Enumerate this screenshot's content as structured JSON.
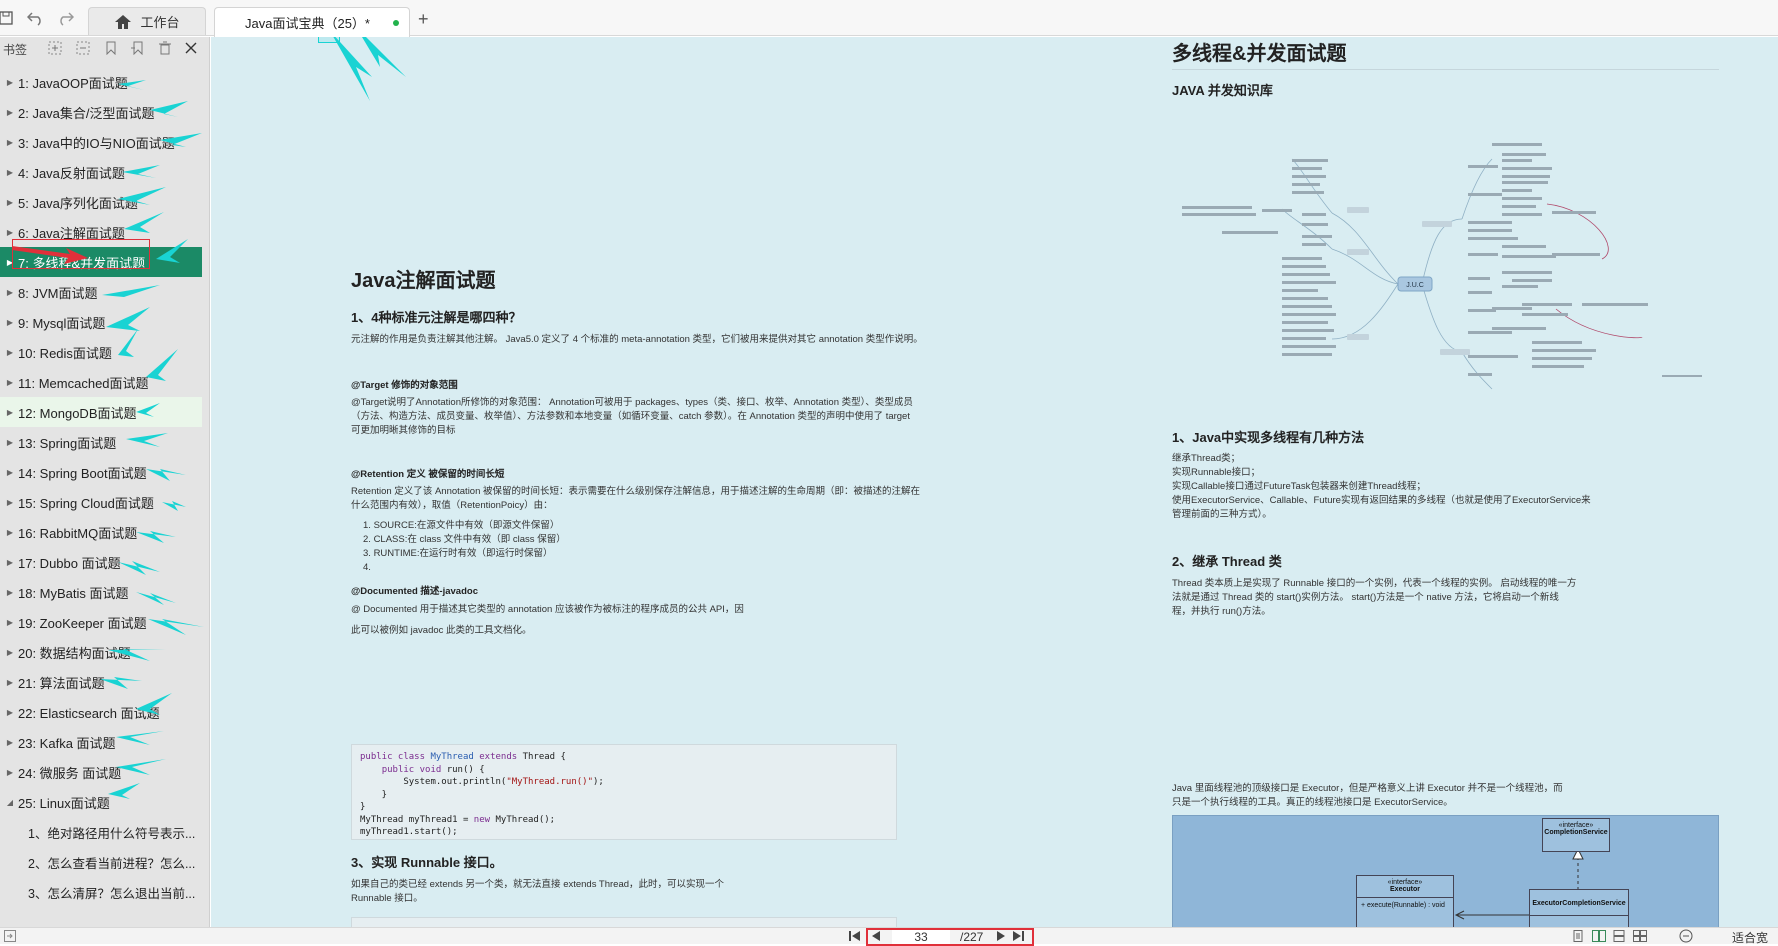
{
  "toolbar": {
    "home_tab_label": "工作台",
    "doc_tab_label": "Java面试宝典（25）*",
    "add_tab": "+"
  },
  "sidebar": {
    "title": "书签",
    "items": [
      {
        "label": "1: JavaOOP面试题",
        "state": "collapsed"
      },
      {
        "label": "2: Java集合/泛型面试题",
        "state": "collapsed"
      },
      {
        "label": "3: Java中的IO与NIO面试题",
        "state": "collapsed"
      },
      {
        "label": "4: Java反射面试题",
        "state": "collapsed"
      },
      {
        "label": "5: Java序列化面试题",
        "state": "collapsed"
      },
      {
        "label": "6: Java注解面试题",
        "state": "collapsed"
      },
      {
        "label": "7: 多线程&并发面试题",
        "state": "active"
      },
      {
        "label": "8: JVM面试题",
        "state": "collapsed"
      },
      {
        "label": "9: Mysql面试题",
        "state": "collapsed"
      },
      {
        "label": "10: Redis面试题",
        "state": "collapsed"
      },
      {
        "label": "11: Memcached面试题",
        "state": "collapsed"
      },
      {
        "label": "12: MongoDB面试题",
        "state": "hover"
      },
      {
        "label": "13: Spring面试题",
        "state": "collapsed"
      },
      {
        "label": "14: Spring Boot面试题",
        "state": "collapsed"
      },
      {
        "label": "15: Spring Cloud面试题",
        "state": "collapsed"
      },
      {
        "label": "16: RabbitMQ面试题",
        "state": "collapsed"
      },
      {
        "label": "17: Dubbo 面试题",
        "state": "collapsed"
      },
      {
        "label": "18: MyBatis 面试题",
        "state": "collapsed"
      },
      {
        "label": "19: ZooKeeper 面试题",
        "state": "collapsed"
      },
      {
        "label": "20: 数据结构面试题",
        "state": "collapsed"
      },
      {
        "label": "21: 算法面试题",
        "state": "collapsed"
      },
      {
        "label": "22: Elasticsearch 面试题",
        "state": "collapsed"
      },
      {
        "label": "23: Kafka 面试题",
        "state": "collapsed"
      },
      {
        "label": "24: 微服务 面试题",
        "state": "collapsed"
      },
      {
        "label": "25: Linux面试题",
        "state": "expanded"
      }
    ],
    "subitems": [
      {
        "label": "1、绝对路径用什么符号表示..."
      },
      {
        "label": "2、怎么查看当前进程？怎么..."
      },
      {
        "label": "3、怎么清屏？怎么退出当前..."
      }
    ]
  },
  "left_page": {
    "title": "Java注解面试题",
    "q1": "1、4种标准元注解是哪四种？",
    "intro": "元注解的作用是负责注解其他注解。 Java5.0 定义了 4 个标准的 meta-annotation 类型，它们被用来提供对其它 annotation 类型作说明。",
    "target_head": "@Target 修饰的对象范围",
    "target_body_1": "@Target说明了Annotation所修饰的对象范围： Annotation可被用于 packages、types（类、接口、枚举、Annotation 类型）、类型成员",
    "target_body_2": "（方法、构造方法、成员变量、枚举值）、方法参数和本地变量（如循环变量、catch 参数）。在 Annotation 类型的声明中使用了 target",
    "target_body_3": "可更加明晰其修饰的目标",
    "retention_head": "@Retention 定义 被保留的时间长短",
    "retention_body_1": "Retention 定义了该 Annotation 被保留的时间长短：表示需要在什么级别保存注解信息，用于描述注解的生命周期（即：被描述的注解在",
    "retention_body_2": "什么范围内有效），取值（RetentionPoicy）由：",
    "retention_list": [
      "SOURCE:在源文件中有效（即源文件保留）",
      "CLASS:在 class 文件中有效（即 class 保留）",
      "RUNTIME:在运行时有效（即运行时保留）",
      ""
    ],
    "documented_head": "@Documented 描述-javadoc",
    "documented_body": "@ Documented 用于描述其它类型的 annotation 应该被作为被标注的程序成员的公共 API，因",
    "documented_body_2": "此可以被例如 javadoc 此类的工具文档化。",
    "code_lines": [
      "public class MyThread extends Thread {",
      "    public void run() {",
      "        System.out.println(\"MyThread.run()\");",
      "    }",
      "}",
      "MyThread myThread1 = new MyThread();",
      "myThread1.start();"
    ],
    "q3": "3、实现 Runnable 接口。",
    "q3_body_1": "如果自己的类已经 extends 另一个类，就无法直接 extends Thread，此时，可以实现一个",
    "q3_body_2": "Runnable 接口。"
  },
  "right_page": {
    "title": "多线程&并发面试题",
    "subtitle": "JAVA 并发知识库",
    "q1": "1、Java中实现多线程有几种方法",
    "q1_lines": [
      "继承Thread类；",
      "实现Runnable接口；",
      "实现Callable接口通过FutureTask包装器来创建Thread线程；",
      "使用ExecutorService、Callable、Future实现有返回结果的多线程（也就是使用了ExecutorService来",
      "管理前面的三种方式）。"
    ],
    "q2": "2、继承 Thread 类",
    "q2_lines": [
      "Thread 类本质上是实现了 Runnable 接口的一个实例，代表一个线程的实例。 启动线程的唯一方",
      "法就是通过 Thread 类的 start()实例方法。 start()方法是一个 native 方法，它将启动一个新线",
      "程，并执行 run()方法。"
    ],
    "executor_lines": [
      "Java 里面线程池的顶级接口是 Executor，但是严格意义上讲 Executor 并不是一个线程池，而",
      "只是一个执行线程的工具。真正的线程池接口是 ExecutorService。"
    ],
    "mindmap_center": "J.U.C",
    "uml_completion_stereo": "«interface»",
    "uml_completion_name": "CompletionService",
    "uml_executor_stereo": "«interface»",
    "uml_executor_name": "Executor",
    "uml_executor_method": "+ execute(Runnable) : void",
    "uml_ecs_name": "ExecutorCompletionService"
  },
  "statusbar": {
    "current_page": "33",
    "total_pages": "/227",
    "zoom_label": "适合宽"
  },
  "colors": {
    "active_bookmark": "#1b8a66",
    "annotation_arrow": "#19d3d3",
    "highlight_box": "#e0303a",
    "page_background": "#d9edf2"
  }
}
